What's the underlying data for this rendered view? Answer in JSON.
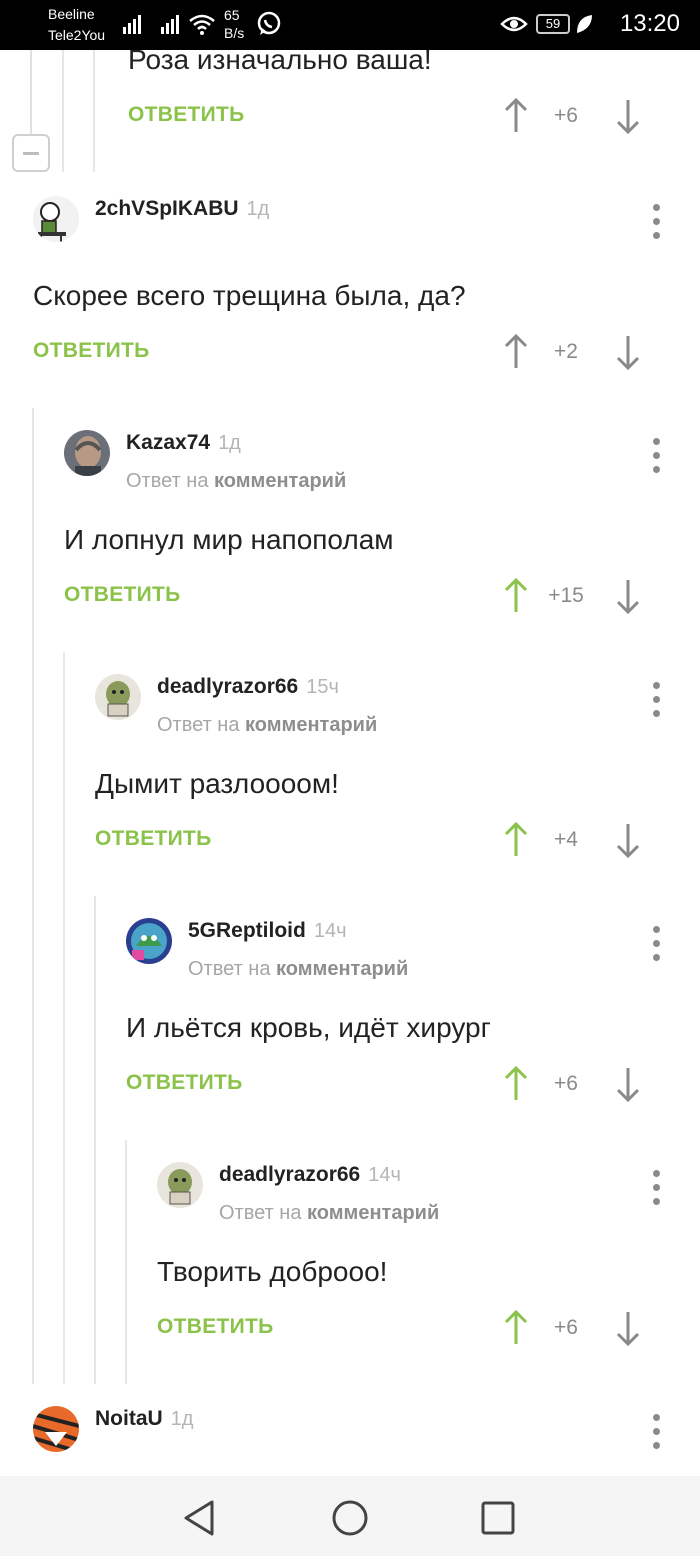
{
  "status_bar": {
    "carrier_1": "Beeline",
    "carrier_2": "Tele2You",
    "speed_value": "65",
    "speed_unit": "B/s",
    "battery": "59",
    "time": "13:20"
  },
  "reply_label": "ОТВЕТИТЬ",
  "reply_to_prefix": "Ответ на",
  "reply_to_target": "комментарий",
  "top_fragment": {
    "text": "Роза изначально ваша!",
    "rating": "+6"
  },
  "comments": [
    {
      "author": "2chVSpIKABU",
      "time": "1д",
      "text": "Скорее всего трещина была, да?",
      "rating": "+2",
      "upvoted": false,
      "is_reply": false
    },
    {
      "author": "Kazax74",
      "time": "1д",
      "text": "И лопнул мир напополам",
      "rating": "+15",
      "upvoted": true,
      "is_reply": true
    },
    {
      "author": "deadlyrazor66",
      "time": "15ч",
      "text": "Дымит разлоооом!",
      "rating": "+4",
      "upvoted": true,
      "is_reply": true
    },
    {
      "author": "5GReptiloid",
      "time": "14ч",
      "text": "И льётся кровь, идёт хирург",
      "rating": "+6",
      "upvoted": true,
      "is_reply": true
    },
    {
      "author": "deadlyrazor66",
      "time": "14ч",
      "text": "Творить доброоо!",
      "rating": "+6",
      "upvoted": true,
      "is_reply": true
    }
  ],
  "bottom_comment": {
    "author": "NoitaU",
    "time": "1д"
  },
  "colors": {
    "accent_green": "#8bc34a",
    "vote_gray": "#8a8a8a",
    "thread_line": "#e6e6e6"
  },
  "icons": [
    "eye-icon",
    "whatsapp-icon",
    "wifi-icon",
    "signal-icon",
    "leaf-icon",
    "more-vert-icon",
    "arrow-up-icon",
    "arrow-down-icon",
    "nav-back-icon",
    "nav-home-icon",
    "nav-recents-icon"
  ]
}
